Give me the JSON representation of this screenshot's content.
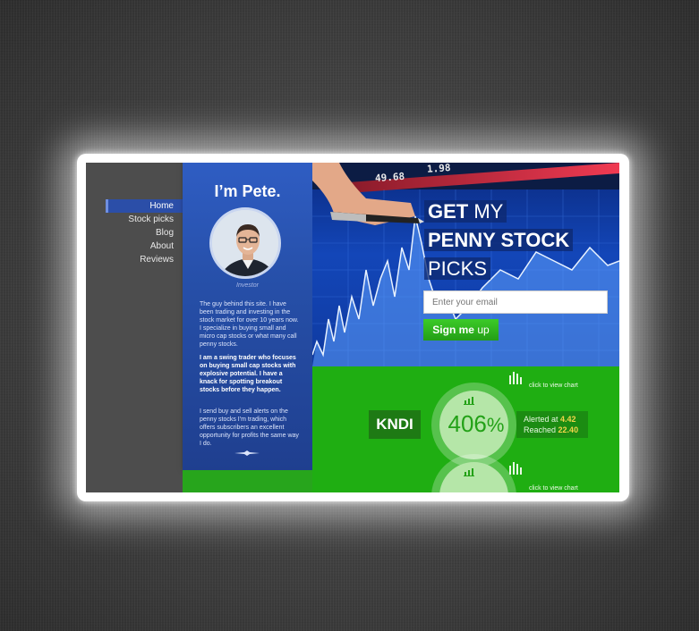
{
  "nav": {
    "items": [
      {
        "label": "Home",
        "active": true
      },
      {
        "label": "Stock picks",
        "active": false
      },
      {
        "label": "Blog",
        "active": false
      },
      {
        "label": "About",
        "active": false
      },
      {
        "label": "Reviews",
        "active": false
      }
    ]
  },
  "profile": {
    "title": "I’m Pete.",
    "caption": "Investor",
    "bio_1": "The guy behind this site. I have been trading and investing in the stock market for over 10 years now. I specialize in buying small and micro cap stocks or what many call penny stocks.",
    "bio_2": "I am a swing trader who focuses on buying small cap stocks with explosive potential. I have a knack for spotting breakout stocks before they happen.",
    "bio_3": "I send buy and sell alerts on the penny stocks I'm trading, which offers subscribers an excellent opportunity for profits the same way I do."
  },
  "hero": {
    "ticker_a": "49.68",
    "ticker_b": "1.98",
    "line1_bold": "GET",
    "line1_light": "MY",
    "line2": "PENNY STOCK",
    "line3": "PICKS",
    "email_placeholder": "Enter your email",
    "signup_bold": "Sign me",
    "signup_light": "up"
  },
  "picks": [
    {
      "ticker": "KNDI",
      "percent": "406",
      "percent_symbol": "%",
      "alerted_label": "Alerted at",
      "alerted_value": "4.42",
      "reached_label": "Reached",
      "reached_value": "22.40",
      "chart_link": "click to view chart"
    },
    {
      "chart_link": "click to view chart"
    }
  ],
  "colors": {
    "nav_active": "#2b4ea8",
    "profile_blue": "#264fa8",
    "green": "#1fae12",
    "signup": "#2fb71f",
    "value_gold": "#f2d54a"
  }
}
